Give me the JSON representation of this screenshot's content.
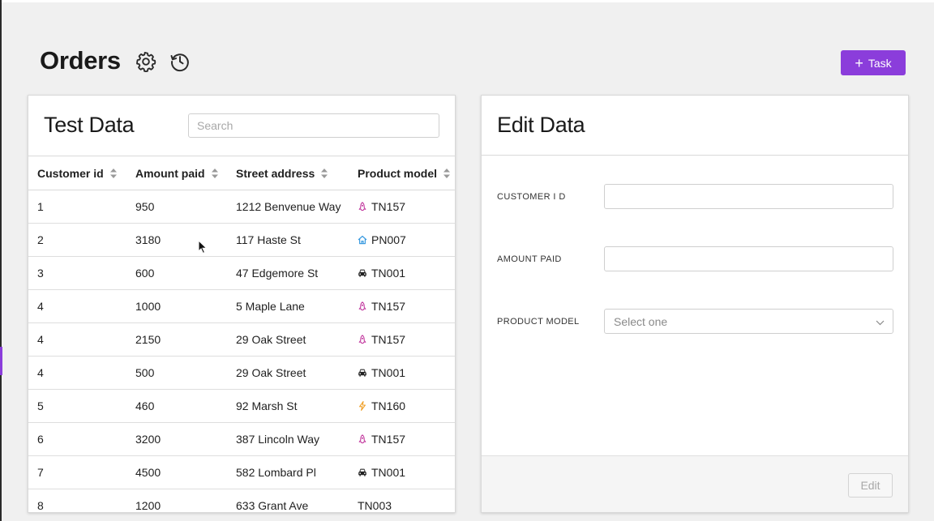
{
  "header": {
    "title": "Orders",
    "task_button_label": "Task",
    "icons": [
      "gear-icon",
      "history-icon"
    ]
  },
  "test_data": {
    "title": "Test Data",
    "search_placeholder": "Search",
    "columns": [
      "Customer id",
      "Amount paid",
      "Street address",
      "Product model"
    ],
    "rows": [
      {
        "customer_id": "1",
        "amount_paid": "950",
        "street_address": "1212 Benvenue Way",
        "product_model": "TN157",
        "icon": "rocket-icon"
      },
      {
        "customer_id": "2",
        "amount_paid": "3180",
        "street_address": "117 Haste St",
        "product_model": "PN007",
        "icon": "home-icon"
      },
      {
        "customer_id": "3",
        "amount_paid": "600",
        "street_address": "47 Edgemore St",
        "product_model": "TN001",
        "icon": "car-icon"
      },
      {
        "customer_id": "4",
        "amount_paid": "1000",
        "street_address": "5 Maple Lane",
        "product_model": "TN157",
        "icon": "rocket-icon"
      },
      {
        "customer_id": "4",
        "amount_paid": "2150",
        "street_address": "29 Oak Street",
        "product_model": "TN157",
        "icon": "rocket-icon"
      },
      {
        "customer_id": "4",
        "amount_paid": "500",
        "street_address": "29 Oak Street",
        "product_model": "TN001",
        "icon": "car-icon"
      },
      {
        "customer_id": "5",
        "amount_paid": "460",
        "street_address": "92 Marsh St",
        "product_model": "TN160",
        "icon": "lightning-icon"
      },
      {
        "customer_id": "6",
        "amount_paid": "3200",
        "street_address": "387 Lincoln Way",
        "product_model": "TN157",
        "icon": "rocket-icon"
      },
      {
        "customer_id": "7",
        "amount_paid": "4500",
        "street_address": "582 Lombard Pl",
        "product_model": "TN001",
        "icon": "car-icon"
      },
      {
        "customer_id": "8",
        "amount_paid": "1200",
        "street_address": "633 Grant Ave",
        "product_model": "TN003",
        "icon": ""
      }
    ]
  },
  "edit_data": {
    "title": "Edit Data",
    "fields": {
      "customer_id": {
        "label": "CUSTOMER I D",
        "value": ""
      },
      "amount_paid": {
        "label": "AMOUNT PAID",
        "value": ""
      },
      "product_model": {
        "label": "PRODUCT MODEL",
        "placeholder": "Select one"
      }
    },
    "edit_button_label": "Edit"
  },
  "colors": {
    "accent": "#8b3ddb",
    "rocket": "#c2399e",
    "home": "#3b9be0",
    "car": "#222222",
    "lightning": "#f0a028"
  }
}
